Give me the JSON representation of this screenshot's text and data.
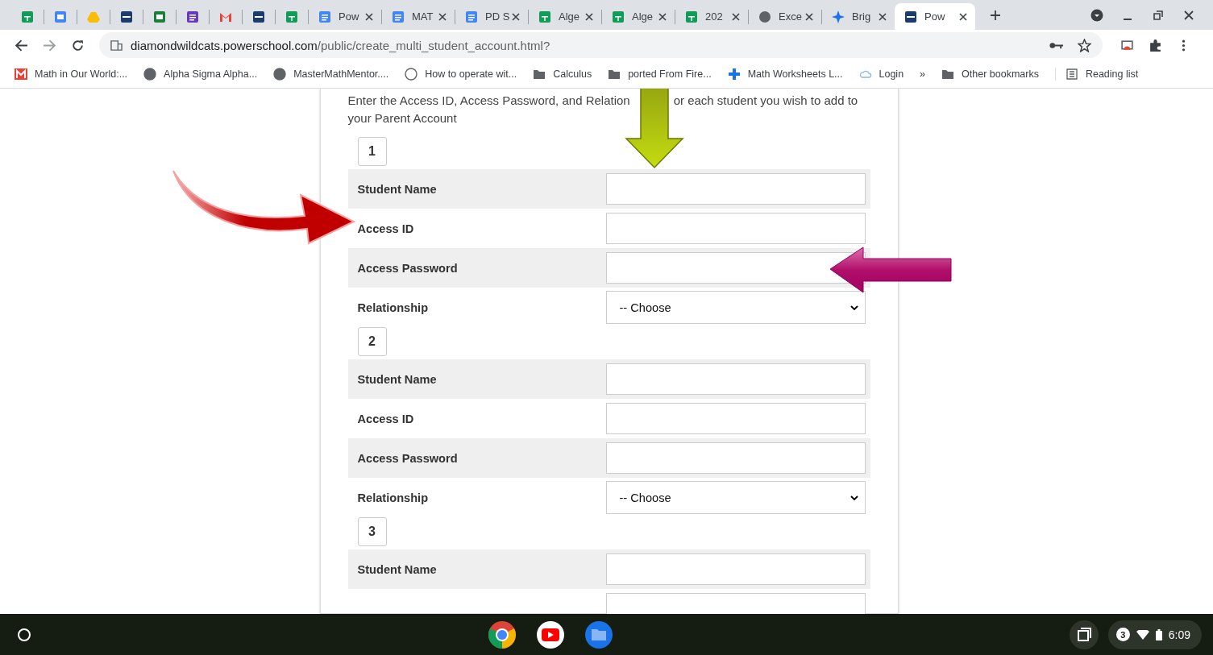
{
  "tabs": [
    {
      "kind": "sheets",
      "selected": false
    },
    {
      "kind": "calendar",
      "selected": false
    },
    {
      "kind": "drive",
      "selected": false
    },
    {
      "kind": "sis",
      "selected": false
    },
    {
      "kind": "classroom",
      "selected": false
    },
    {
      "kind": "forms",
      "selected": false
    },
    {
      "kind": "gmail",
      "selected": false
    },
    {
      "kind": "sis",
      "selected": false
    },
    {
      "kind": "sheets",
      "selected": false
    },
    {
      "kind": "docs",
      "title": "Pow",
      "selected": false
    },
    {
      "kind": "docs",
      "title": "MAT",
      "selected": false
    },
    {
      "kind": "docs",
      "title": "PD S",
      "selected": false
    },
    {
      "kind": "sheets",
      "title": "Alge",
      "selected": false
    },
    {
      "kind": "sheets",
      "title": "Alge",
      "selected": false
    },
    {
      "kind": "sheets",
      "title": "202",
      "selected": false
    },
    {
      "kind": "globe",
      "title": "Exce",
      "selected": false
    },
    {
      "kind": "star",
      "title": "Brig",
      "selected": false
    },
    {
      "kind": "sis",
      "title": "Pow",
      "selected": true
    }
  ],
  "address": {
    "host": "diamondwildcats.powerschool.com",
    "path": "/public/create_multi_student_account.html?"
  },
  "bookmarks": [
    {
      "kind": "gmail",
      "label": "Math in Our World:..."
    },
    {
      "kind": "globe",
      "label": "Alpha Sigma Alpha..."
    },
    {
      "kind": "globe",
      "label": "MasterMathMentor...."
    },
    {
      "kind": "planet",
      "label": "How to operate wit..."
    },
    {
      "kind": "folder",
      "label": "Calculus"
    },
    {
      "kind": "folder",
      "label": "ported From Fire..."
    },
    {
      "kind": "cross",
      "label": "Math Worksheets L..."
    },
    {
      "kind": "cloud",
      "label": "Login"
    },
    {
      "kind": "more",
      "label": "»"
    },
    {
      "kind": "folder",
      "label": "Other bookmarks"
    },
    {
      "kind": "list",
      "label": "Reading list"
    }
  ],
  "intro": {
    "before": "Enter the Access ID, Access Password, and Relation",
    "after": "or each student you wish to add to your Parent Account"
  },
  "students": [
    {
      "number": "1",
      "fields": [
        {
          "label": "Student Name",
          "kind": "text"
        },
        {
          "label": "Access ID",
          "kind": "text"
        },
        {
          "label": "Access Password",
          "kind": "text"
        },
        {
          "label": "Relationship",
          "kind": "select",
          "value": "-- Choose"
        }
      ]
    },
    {
      "number": "2",
      "fields": [
        {
          "label": "Student Name",
          "kind": "text"
        },
        {
          "label": "Access ID",
          "kind": "text"
        },
        {
          "label": "Access Password",
          "kind": "text"
        },
        {
          "label": "Relationship",
          "kind": "select",
          "value": "-- Choose"
        }
      ]
    },
    {
      "number": "3",
      "fields": [
        {
          "label": "Student Name",
          "kind": "text"
        },
        {
          "kind": "text"
        }
      ]
    }
  ],
  "shelf": {
    "notifications": "3",
    "time": "6:09"
  }
}
